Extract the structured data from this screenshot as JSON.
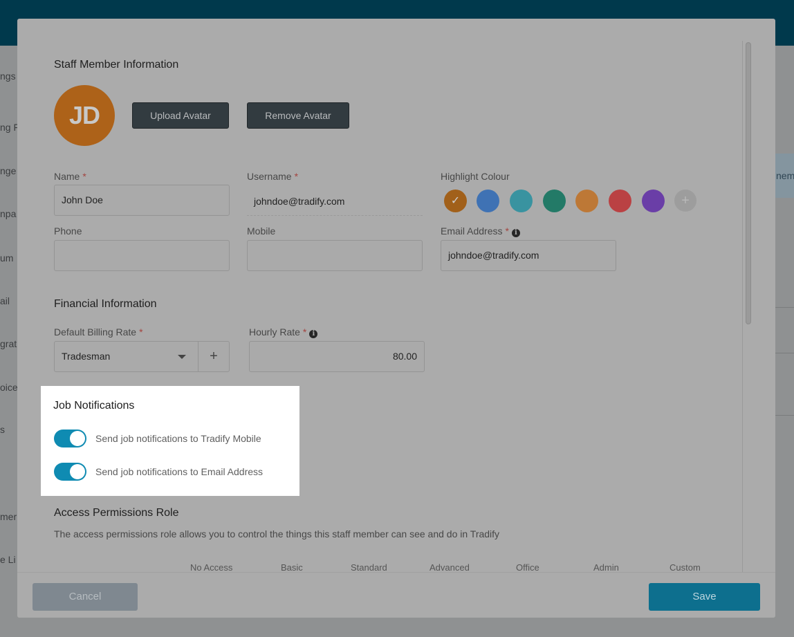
{
  "background": {
    "nav_items": [
      "ngs",
      "ng F",
      "nge",
      "npa",
      "um",
      "ail",
      "grat",
      "oice",
      "s",
      "mer",
      "e Li"
    ],
    "right_panel_text": "nem"
  },
  "staff_info": {
    "title": "Staff Member Information",
    "avatar_initials": "JD",
    "avatar_color": "#ad6219",
    "upload_button": "Upload Avatar",
    "remove_button": "Remove Avatar",
    "name_label": "Name",
    "name_value": "John Doe",
    "username_label": "Username",
    "username_value": "johndoe@tradify.com",
    "highlight_label": "Highlight Colour",
    "highlight_colors": [
      "#a1601a",
      "#3f72b4",
      "#3993a0",
      "#237a67",
      "#bd7836",
      "#ba4143",
      "#6a3ea7",
      "#9d9d9d"
    ],
    "selected_check": "✓",
    "add_color_symbol": "+",
    "phone_label": "Phone",
    "phone_value": "",
    "mobile_label": "Mobile",
    "mobile_value": "",
    "email_label": "Email Address",
    "email_value": "johndoe@tradify.com",
    "required_marker": "*",
    "info_symbol": "i"
  },
  "financial": {
    "title": "Financial Information",
    "billing_rate_label": "Default Billing Rate",
    "billing_rate_value": "Tradesman",
    "add_symbol": "+",
    "hourly_rate_label": "Hourly Rate",
    "hourly_rate_value": "80.00"
  },
  "job_notifications": {
    "title": "Job Notifications",
    "toggles": [
      {
        "label": "Send job notifications to Tradify Mobile",
        "on": true
      },
      {
        "label": "Send job notifications to Email Address",
        "on": true
      }
    ],
    "toggle_color": "#0f8bb2"
  },
  "access_permissions": {
    "title": "Access Permissions Role",
    "description": "The access permissions role allows you to control the things this staff member can see and do in Tradify",
    "columns": [
      "No Access",
      "Basic",
      "Standard",
      "Advanced",
      "Office",
      "Admin",
      "Custom"
    ]
  },
  "footer": {
    "cancel": "Cancel",
    "save": "Save"
  }
}
